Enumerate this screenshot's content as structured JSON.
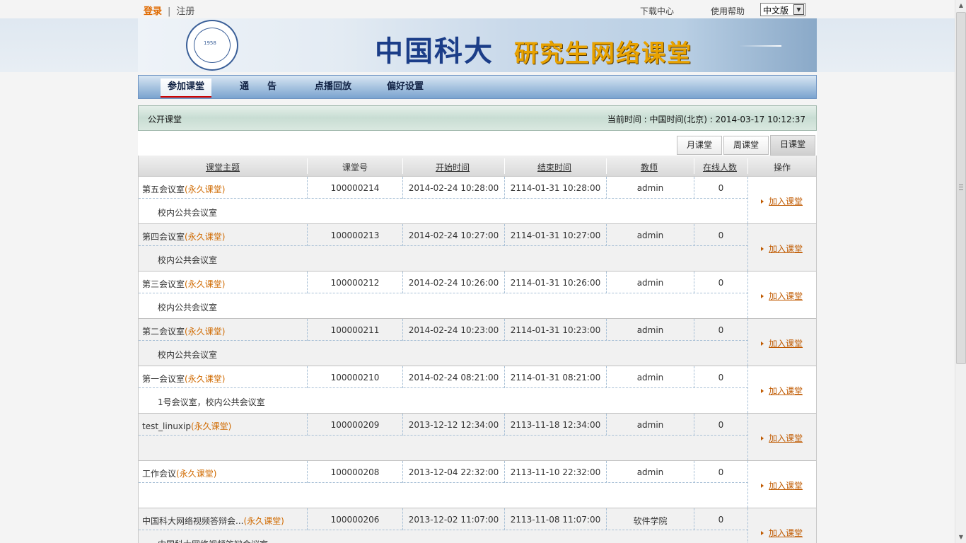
{
  "top": {
    "login": "登录",
    "separator": "|",
    "register": "注册",
    "download": "下载中心",
    "help": "使用帮助",
    "language": "中文版"
  },
  "banner": {
    "title_main": "中国科大",
    "title_sub": "研究生网络课堂",
    "seal_year": "1958"
  },
  "nav": {
    "items": [
      {
        "label": "参加课堂"
      },
      {
        "label": "通　　告"
      },
      {
        "label": "点播回放"
      },
      {
        "label": "偏好设置"
      }
    ]
  },
  "section": {
    "title": "公开课堂",
    "current_time": "当前时间 : 中国时间(北京) : 2014-03-17 10:12:37"
  },
  "tabs": [
    {
      "label": "月课堂"
    },
    {
      "label": "周课堂"
    },
    {
      "label": "日课堂"
    }
  ],
  "table": {
    "headers": {
      "topic": "课堂主题",
      "id": "课堂号",
      "start": "开始时间",
      "end": "结束时间",
      "teacher": "教师",
      "online": "在线人数",
      "action": "操作"
    },
    "rows": [
      {
        "name": "第五会议室",
        "tag": "(永久课堂)",
        "id": "100000214",
        "start": "2014-02-24 10:28:00",
        "end": "2114-01-31 10:28:00",
        "teacher": "admin",
        "online": "0",
        "desc": "校内公共会议室",
        "action": "加入课堂"
      },
      {
        "name": "第四会议室",
        "tag": "(永久课堂)",
        "id": "100000213",
        "start": "2014-02-24 10:27:00",
        "end": "2114-01-31 10:27:00",
        "teacher": "admin",
        "online": "0",
        "desc": "校内公共会议室",
        "action": "加入课堂"
      },
      {
        "name": "第三会议室",
        "tag": "(永久课堂)",
        "id": "100000212",
        "start": "2014-02-24 10:26:00",
        "end": "2114-01-31 10:26:00",
        "teacher": "admin",
        "online": "0",
        "desc": "校内公共会议室",
        "action": "加入课堂"
      },
      {
        "name": "第二会议室",
        "tag": "(永久课堂)",
        "id": "100000211",
        "start": "2014-02-24 10:23:00",
        "end": "2114-01-31 10:23:00",
        "teacher": "admin",
        "online": "0",
        "desc": "校内公共会议室",
        "action": "加入课堂"
      },
      {
        "name": "第一会议室",
        "tag": "(永久课堂)",
        "id": "100000210",
        "start": "2014-02-24 08:21:00",
        "end": "2114-01-31 08:21:00",
        "teacher": "admin",
        "online": "0",
        "desc": "1号会议室，校内公共会议室",
        "action": "加入课堂"
      },
      {
        "name": "test_linuxip",
        "tag": "(永久课堂)",
        "id": "100000209",
        "start": "2013-12-12 12:34:00",
        "end": "2113-11-18 12:34:00",
        "teacher": "admin",
        "online": "0",
        "desc": "",
        "action": "加入课堂"
      },
      {
        "name": "工作会议",
        "tag": "(永久课堂)",
        "id": "100000208",
        "start": "2013-12-04 22:32:00",
        "end": "2113-11-10 22:32:00",
        "teacher": "admin",
        "online": "0",
        "desc": "",
        "action": "加入课堂"
      },
      {
        "name": "中国科大网络视频答辩会...",
        "tag": "(永久课堂)",
        "id": "100000206",
        "start": "2013-12-02 11:07:00",
        "end": "2113-11-08 11:07:00",
        "teacher": "软件学院",
        "online": "0",
        "desc": "中国科大网络视频答辩会议室",
        "action": "加入课堂"
      }
    ]
  }
}
